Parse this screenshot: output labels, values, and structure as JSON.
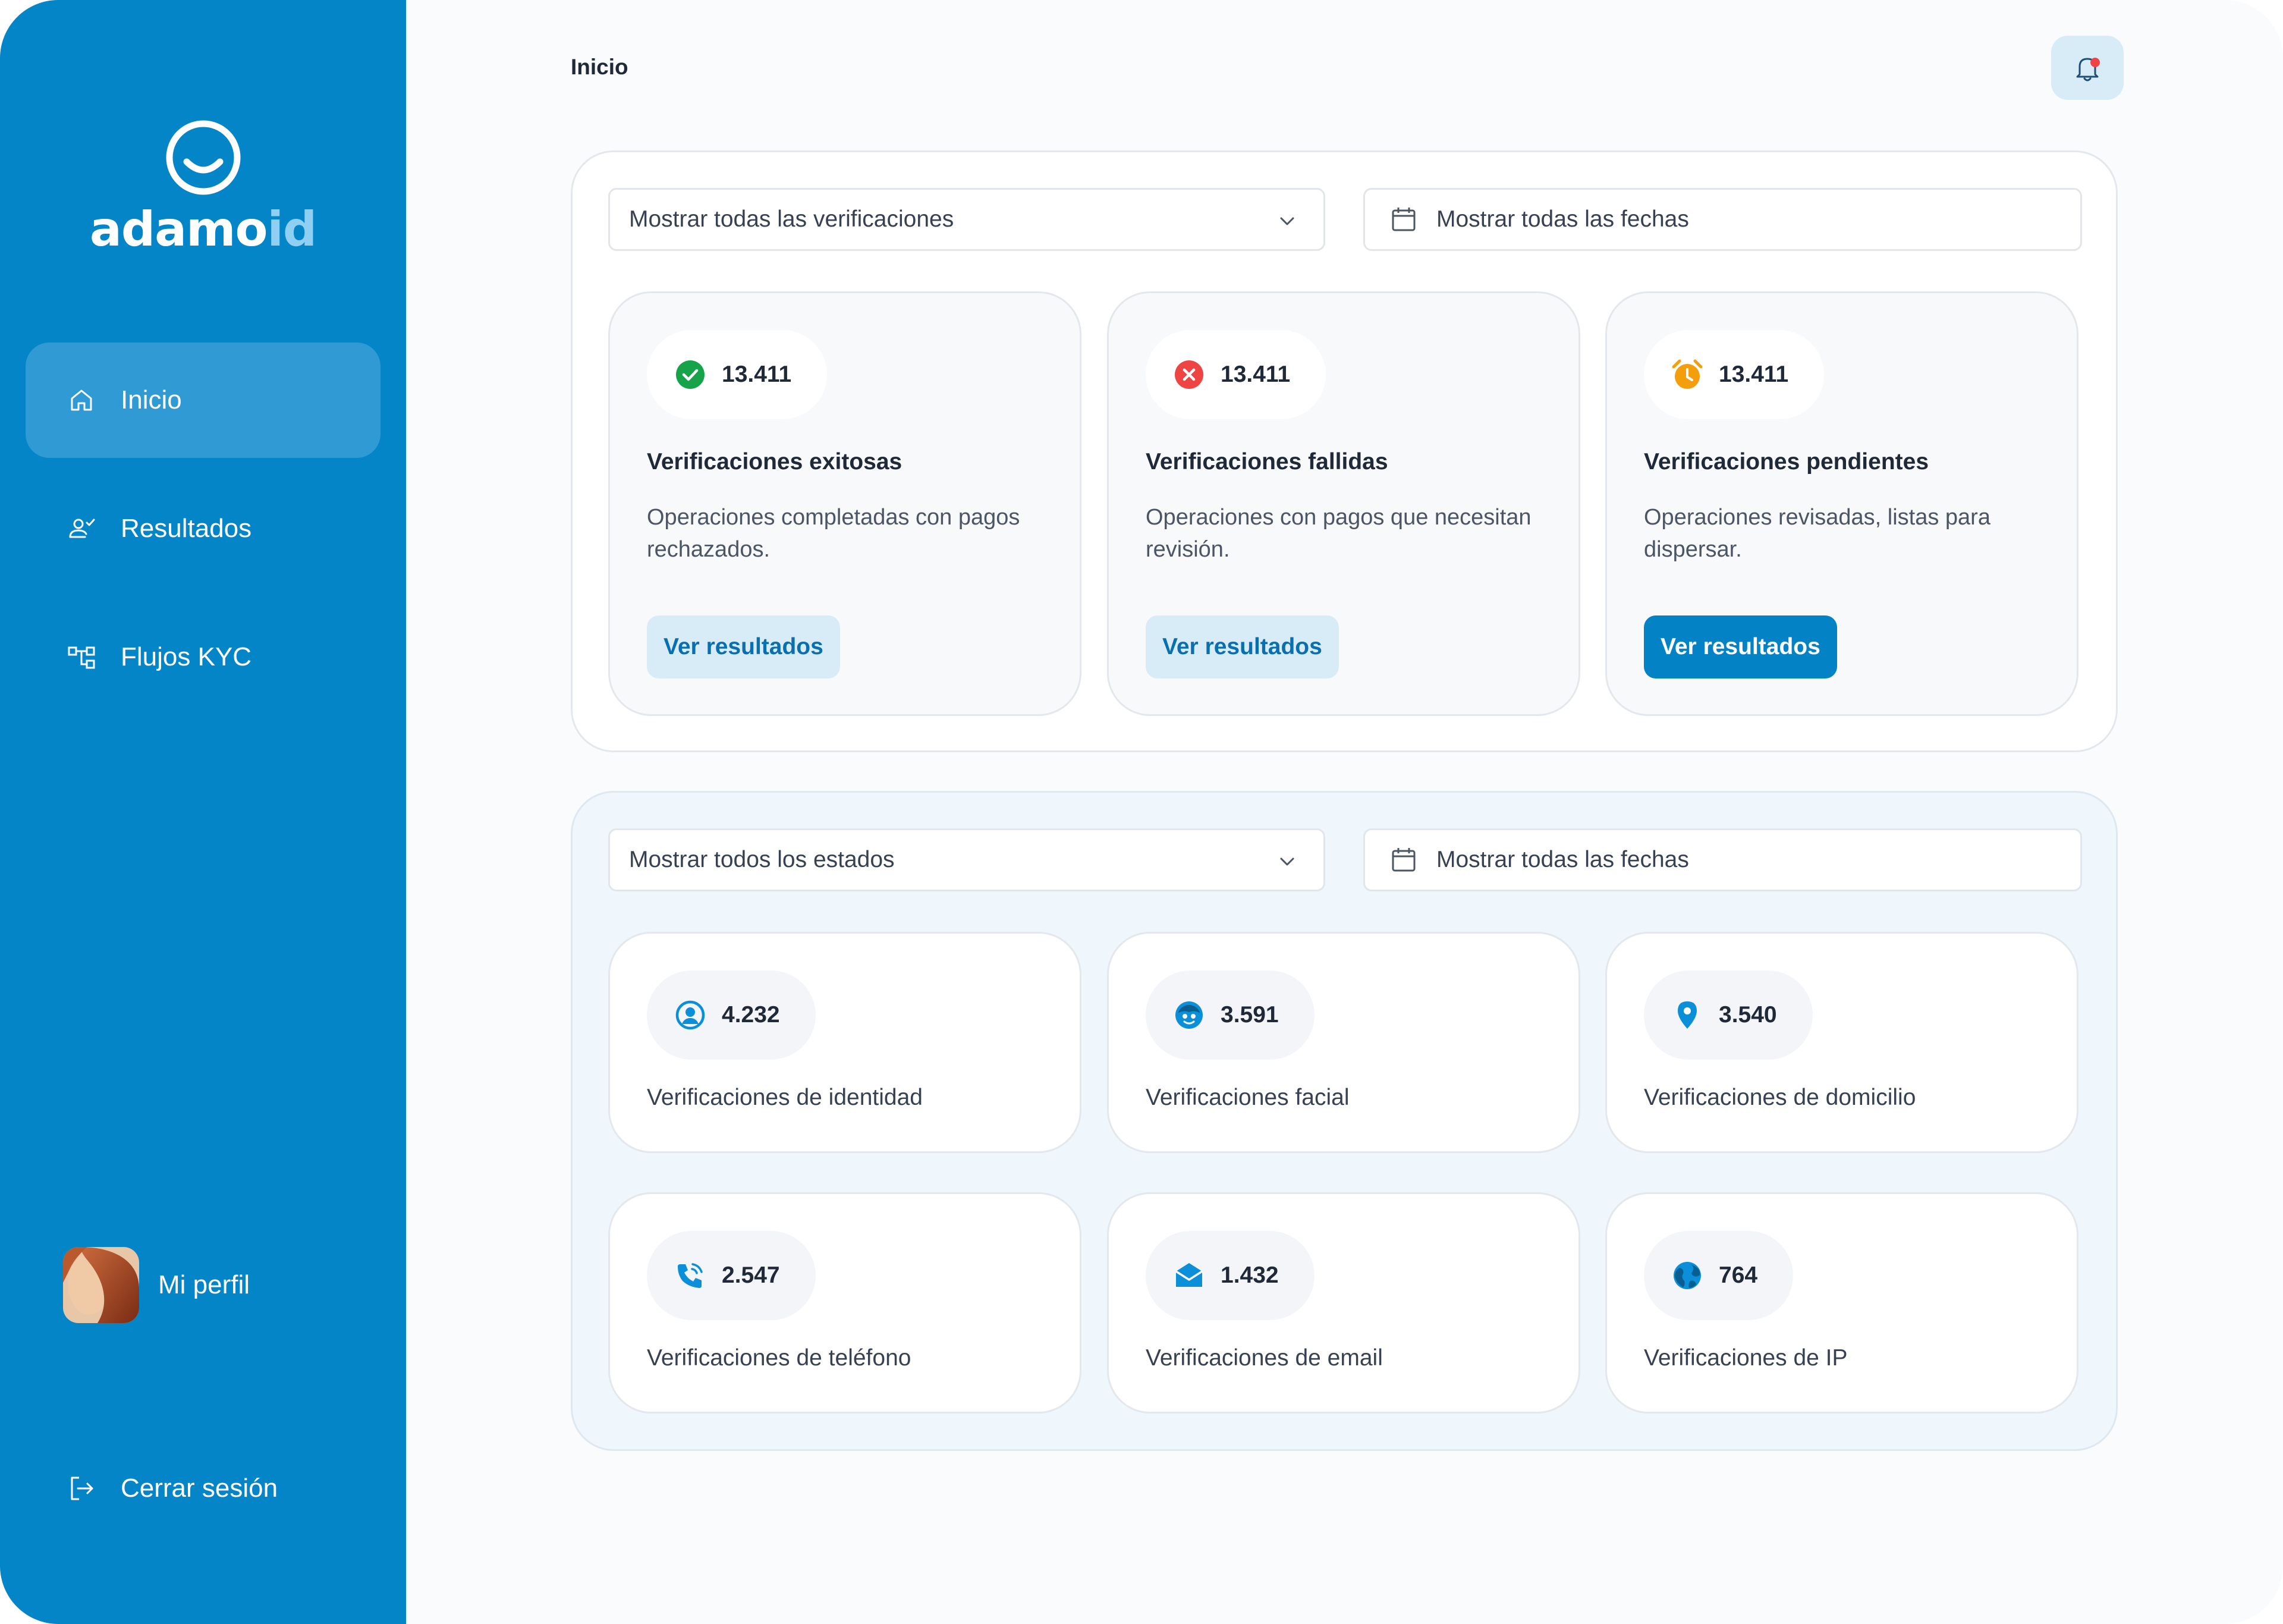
{
  "brand": {
    "name_part1": "adamo",
    "name_part2": "id"
  },
  "sidebar": {
    "items": [
      {
        "label": "Inicio",
        "icon": "home-icon",
        "active": true
      },
      {
        "label": "Resultados",
        "icon": "user-check-icon",
        "active": false
      },
      {
        "label": "Flujos KYC",
        "icon": "flow-icon",
        "active": false
      }
    ],
    "profile_label": "Mi perfil",
    "logout_label": "Cerrar sesión"
  },
  "header": {
    "title": "Inicio",
    "bell_icon": "bell-icon",
    "has_notification": true
  },
  "panel1": {
    "select_value": "Mostrar todas las verificaciones",
    "date_value": "Mostrar todas las fechas",
    "cards": [
      {
        "count": "13.411",
        "icon": "check-circle-icon",
        "icon_color": "#16a34a",
        "title": "Verificaciones exitosas",
        "description": "Operaciones completadas con pagos rechazados.",
        "button": "Ver resultados"
      },
      {
        "count": "13.411",
        "icon": "x-circle-icon",
        "icon_color": "#ef4444",
        "title": "Verificaciones fallidas",
        "description": "Operaciones con pagos que necesitan revisión.",
        "button": "Ver resultados"
      },
      {
        "count": "13.411",
        "icon": "alarm-clock-icon",
        "icon_color": "#f59e0b",
        "title": "Verificaciones pendientes",
        "description": "Operaciones revisadas, listas para dispersar.",
        "button": "Ver resultados"
      }
    ]
  },
  "panel2": {
    "select_value": "Mostrar todos los estados",
    "date_value": "Mostrar todas las fechas",
    "stats": [
      {
        "count": "4.232",
        "icon": "user-circle-icon",
        "label": "Verificaciones de identidad"
      },
      {
        "count": "3.591",
        "icon": "face-icon",
        "label": "Verificaciones facial"
      },
      {
        "count": "3.540",
        "icon": "location-pin-icon",
        "label": "Verificaciones de domicilio"
      },
      {
        "count": "2.547",
        "icon": "phone-icon",
        "label": "Verificaciones de teléfono"
      },
      {
        "count": "1.432",
        "icon": "mail-icon",
        "label": "Verificaciones de email"
      },
      {
        "count": "764",
        "icon": "globe-icon",
        "label": "Verificaciones de IP"
      }
    ]
  },
  "colors": {
    "sidebar": "#0485c8",
    "accent": "#0482c6",
    "icon_blue": "#0a8fd8"
  }
}
